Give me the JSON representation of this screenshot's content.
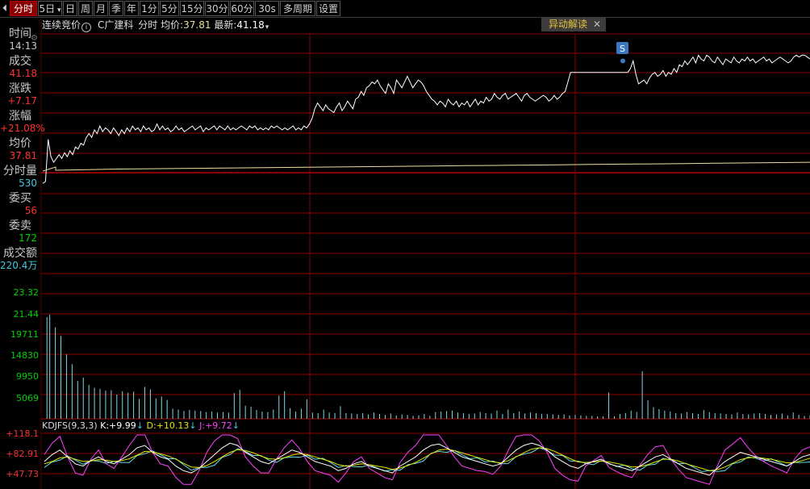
{
  "toolbar": {
    "arrow_icon": "step-back-icon",
    "tabs": [
      "分时",
      "5日",
      "日",
      "周",
      "月",
      "季",
      "年",
      "1分",
      "5分",
      "15分",
      "30分",
      "60分",
      "30s",
      "多周期",
      "设置"
    ],
    "active": "分时"
  },
  "sidebar": {
    "time_label": "时间",
    "time_value": "14:13",
    "deal_label": "成交",
    "deal_value": "41.18",
    "change_label": "涨跌",
    "change_value": "+7.17",
    "pct_label": "涨幅",
    "pct_value": "+21.08%",
    "avg_label": "均价",
    "avg_value": "37.81",
    "vol_label": "分时量",
    "vol_value": "530",
    "buy_label": "委买",
    "buy_value": "56",
    "sell_label": "委卖",
    "sell_value": "172",
    "amount_label": "成交额",
    "amount_value": "220.4万"
  },
  "infobar": {
    "mode": "连续竞价",
    "info_icon": "info-circle-icon",
    "stock": "C广建科",
    "period": "分时",
    "avg_label": "均价:",
    "avg_value": "37.81",
    "latest_label": "最新:",
    "latest_value": "41.18"
  },
  "abnormal_button": {
    "label": "异动解读",
    "close_icon": "close-icon"
  },
  "marker": {
    "label": "S"
  },
  "volume_axis": {
    "ticks": [
      "23.32",
      "21.44",
      "19711",
      "14830",
      "9950",
      "5069"
    ]
  },
  "kdj": {
    "name": "KDJFS(9,3,3)",
    "k_label": "K:",
    "k_value": "+9.99",
    "d_label": "D:",
    "d_value": "+10.13",
    "j_label": "J:",
    "j_value": "+9.72",
    "axis": [
      "+118.1",
      "+82.91",
      "+47.73"
    ]
  },
  "colors": {
    "up": "#ff3030",
    "down": "#00d000",
    "price_line": "#ffffff",
    "avg_line": "#e8e0a0",
    "volume": "#7fd8e8",
    "grid": "#8b0000",
    "k": "#ffffff",
    "d": "#e6e600",
    "j": "#ff40ff",
    "kdj_extra": "#60e0e0"
  },
  "chart_data": {
    "type": "line",
    "series": [
      {
        "name": "成交",
        "values": [
          34.2,
          34.3,
          36.5,
          35.6,
          35.3,
          35.5,
          35.7,
          35.5,
          35.8,
          35.6,
          35.9,
          35.7,
          36.1,
          36.0,
          36.3,
          36.2,
          36.6,
          36.8,
          36.6,
          37.0,
          36.8,
          37.2,
          36.9,
          37.1,
          37.0,
          36.8,
          37.1,
          36.9,
          36.7,
          37.0,
          36.8,
          37.1,
          36.9,
          37.2,
          37.0,
          37.1,
          36.9,
          37.2,
          37.0,
          37.1,
          36.9,
          37.0,
          37.3,
          37.0,
          37.2,
          37.0,
          37.1,
          36.9,
          37.0,
          37.2,
          37.0,
          37.1,
          36.9,
          37.0,
          37.1,
          37.2,
          37.0,
          37.1,
          37.2,
          36.9,
          37.1,
          37.0,
          37.1,
          37.2,
          37.0,
          37.2,
          37.1,
          37.0,
          37.2,
          37.0,
          37.1,
          37.0,
          37.1,
          37.2,
          37.1,
          37.0,
          37.2,
          37.1,
          37.2,
          37.0,
          37.1,
          37.0,
          37.1,
          37.0,
          37.2,
          37.1,
          37.2,
          37.1,
          37.0,
          37.1,
          37.0,
          37.1,
          37.2,
          37.0,
          37.1,
          37.0,
          37.2,
          37.1,
          37.3,
          37.6,
          38.1,
          38.4,
          38.2,
          38.0,
          38.3,
          38.1,
          38.0,
          37.9,
          38.2,
          38.4,
          38.0,
          38.2,
          38.5,
          38.3,
          38.1,
          38.6,
          38.7,
          39.0,
          38.8,
          39.2,
          39.3,
          39.5,
          39.4,
          39.6,
          39.3,
          39.1,
          38.9,
          39.4,
          39.2,
          38.9,
          39.6,
          39.4,
          39.2,
          39.5,
          39.8,
          39.5,
          39.2,
          39.4,
          39.6,
          39.5,
          39.3,
          39.0,
          38.8,
          38.6,
          38.5,
          38.3,
          38.5,
          38.4,
          38.2,
          38.6,
          38.4,
          38.3,
          38.5,
          38.2,
          38.4,
          38.3,
          38.5,
          38.2,
          38.4,
          38.6,
          38.3,
          38.5,
          38.4,
          38.7,
          38.5,
          38.6,
          38.9,
          38.7,
          38.6,
          38.8,
          38.9,
          38.6,
          38.7,
          38.8,
          38.9,
          38.7,
          38.5,
          38.8,
          38.9,
          38.7,
          38.6,
          38.5,
          38.6,
          38.7,
          38.8,
          38.7,
          38.5,
          38.6,
          38.8,
          38.6,
          38.7,
          38.9,
          39.0,
          39.5,
          40.0,
          40.0,
          40.0,
          40.0,
          40.0,
          40.0,
          40.0,
          40.0,
          40.0,
          40.0,
          40.0,
          40.0,
          40.0,
          40.0,
          40.0,
          40.0,
          40.0,
          40.0,
          40.0,
          40.0,
          40.0,
          40.0,
          40.2,
          40.6,
          39.9,
          39.4,
          39.5,
          39.6,
          39.4,
          39.7,
          39.9,
          40.0,
          39.8,
          39.9,
          40.1,
          39.8,
          40.0,
          39.9,
          40.2,
          40.0,
          40.4,
          40.3,
          40.6,
          40.4,
          40.6,
          40.8,
          40.5,
          40.9,
          40.7,
          40.6,
          40.9,
          40.8,
          40.6,
          40.5,
          40.8,
          40.6,
          40.4,
          40.7,
          40.6,
          40.5,
          40.8,
          40.6,
          40.5,
          40.7,
          40.6,
          40.8,
          40.6,
          40.7,
          40.5,
          40.6,
          40.7,
          40.8,
          40.6,
          40.7,
          40.5,
          40.6,
          40.7,
          40.8,
          40.7,
          40.6,
          40.5,
          40.6,
          40.8,
          40.9,
          40.8,
          40.9,
          40.9,
          40.8,
          40.7
        ]
      },
      {
        "name": "均价",
        "values": [
          36.5,
          36.6,
          36.7,
          36.75,
          36.8,
          36.85,
          36.9,
          36.95,
          37.0,
          37.05,
          37.1,
          37.15,
          37.2,
          37.25,
          37.3,
          37.35,
          37.4,
          37.45,
          37.5,
          37.55,
          37.6,
          37.65,
          37.7,
          37.75,
          37.81
        ]
      }
    ],
    "volume": [
      {
        "i": 3,
        "v": 21000
      },
      {
        "i": 5,
        "v": 21500
      },
      {
        "i": 9,
        "v": 18900
      },
      {
        "i": 13,
        "v": 17100
      },
      {
        "i": 17,
        "v": 13300
      },
      {
        "i": 21,
        "v": 11300
      },
      {
        "i": 25,
        "v": 7800
      },
      {
        "i": 29,
        "v": 8500
      },
      {
        "i": 33,
        "v": 7000
      },
      {
        "i": 37,
        "v": 6400
      },
      {
        "i": 41,
        "v": 6200
      },
      {
        "i": 45,
        "v": 5800
      },
      {
        "i": 49,
        "v": 5900
      },
      {
        "i": 53,
        "v": 5000
      },
      {
        "i": 57,
        "v": 5700
      },
      {
        "i": 61,
        "v": 5400
      },
      {
        "i": 65,
        "v": 5600
      },
      {
        "i": 69,
        "v": 4100
      },
      {
        "i": 73,
        "v": 6600
      },
      {
        "i": 77,
        "v": 6100
      },
      {
        "i": 81,
        "v": 4200
      },
      {
        "i": 85,
        "v": 4600
      },
      {
        "i": 89,
        "v": 3900
      },
      {
        "i": 93,
        "v": 2100
      },
      {
        "i": 97,
        "v": 1900
      },
      {
        "i": 101,
        "v": 1600
      },
      {
        "i": 105,
        "v": 1800
      },
      {
        "i": 109,
        "v": 1700
      },
      {
        "i": 113,
        "v": 1600
      },
      {
        "i": 117,
        "v": 1400
      },
      {
        "i": 121,
        "v": 1500
      },
      {
        "i": 125,
        "v": 1300
      },
      {
        "i": 129,
        "v": 1400
      },
      {
        "i": 133,
        "v": 1300
      },
      {
        "i": 137,
        "v": 5300
      },
      {
        "i": 141,
        "v": 6000
      },
      {
        "i": 145,
        "v": 2700
      },
      {
        "i": 149,
        "v": 2500
      },
      {
        "i": 153,
        "v": 1800
      },
      {
        "i": 157,
        "v": 1500
      },
      {
        "i": 161,
        "v": 1400
      },
      {
        "i": 165,
        "v": 1900
      },
      {
        "i": 169,
        "v": 4800
      },
      {
        "i": 173,
        "v": 5700
      },
      {
        "i": 177,
        "v": 2200
      },
      {
        "i": 181,
        "v": 1500
      },
      {
        "i": 185,
        "v": 2100
      },
      {
        "i": 189,
        "v": 4000
      },
      {
        "i": 193,
        "v": 1300
      },
      {
        "i": 197,
        "v": 1200
      },
      {
        "i": 201,
        "v": 1900
      },
      {
        "i": 205,
        "v": 1300
      },
      {
        "i": 209,
        "v": 1200
      },
      {
        "i": 213,
        "v": 2600
      },
      {
        "i": 217,
        "v": 1200
      },
      {
        "i": 221,
        "v": 1100
      },
      {
        "i": 225,
        "v": 1000
      },
      {
        "i": 229,
        "v": 1200
      },
      {
        "i": 233,
        "v": 900
      },
      {
        "i": 237,
        "v": 1300
      },
      {
        "i": 241,
        "v": 1000
      },
      {
        "i": 245,
        "v": 800
      },
      {
        "i": 249,
        "v": 1100
      },
      {
        "i": 253,
        "v": 700
      },
      {
        "i": 257,
        "v": 900
      },
      {
        "i": 261,
        "v": 800
      },
      {
        "i": 265,
        "v": 600
      },
      {
        "i": 269,
        "v": 700
      },
      {
        "i": 273,
        "v": 1000
      },
      {
        "i": 277,
        "v": 600
      },
      {
        "i": 281,
        "v": 1400
      },
      {
        "i": 285,
        "v": 1500
      },
      {
        "i": 289,
        "v": 1600
      },
      {
        "i": 293,
        "v": 1700
      },
      {
        "i": 297,
        "v": 1300
      },
      {
        "i": 301,
        "v": 1200
      },
      {
        "i": 305,
        "v": 1000
      },
      {
        "i": 309,
        "v": 1100
      },
      {
        "i": 313,
        "v": 1400
      },
      {
        "i": 317,
        "v": 1200
      },
      {
        "i": 321,
        "v": 1100
      },
      {
        "i": 325,
        "v": 1700
      },
      {
        "i": 329,
        "v": 1000
      },
      {
        "i": 333,
        "v": 1900
      },
      {
        "i": 337,
        "v": 1200
      },
      {
        "i": 341,
        "v": 1500
      },
      {
        "i": 345,
        "v": 1100
      },
      {
        "i": 349,
        "v": 1300
      },
      {
        "i": 353,
        "v": 1200
      },
      {
        "i": 357,
        "v": 1000
      },
      {
        "i": 361,
        "v": 1000
      },
      {
        "i": 365,
        "v": 900
      },
      {
        "i": 369,
        "v": 800
      },
      {
        "i": 373,
        "v": 900
      },
      {
        "i": 377,
        "v": 700
      },
      {
        "i": 381,
        "v": 800
      },
      {
        "i": 385,
        "v": 700
      },
      {
        "i": 389,
        "v": 600
      },
      {
        "i": 393,
        "v": 600
      },
      {
        "i": 397,
        "v": 500
      },
      {
        "i": 401,
        "v": 500
      },
      {
        "i": 405,
        "v": 5400
      },
      {
        "i": 409,
        "v": 500
      },
      {
        "i": 413,
        "v": 1000
      },
      {
        "i": 417,
        "v": 1200
      },
      {
        "i": 421,
        "v": 1700
      },
      {
        "i": 425,
        "v": 1400
      },
      {
        "i": 429,
        "v": 9800
      },
      {
        "i": 433,
        "v": 3800
      },
      {
        "i": 437,
        "v": 2400
      },
      {
        "i": 441,
        "v": 2000
      },
      {
        "i": 445,
        "v": 1700
      },
      {
        "i": 449,
        "v": 1500
      },
      {
        "i": 453,
        "v": 1200
      },
      {
        "i": 457,
        "v": 1100
      },
      {
        "i": 461,
        "v": 1400
      },
      {
        "i": 465,
        "v": 1200
      },
      {
        "i": 469,
        "v": 1000
      },
      {
        "i": 473,
        "v": 1800
      },
      {
        "i": 477,
        "v": 1400
      },
      {
        "i": 481,
        "v": 1200
      },
      {
        "i": 485,
        "v": 1100
      },
      {
        "i": 489,
        "v": 1000
      },
      {
        "i": 493,
        "v": 900
      },
      {
        "i": 497,
        "v": 1300
      },
      {
        "i": 501,
        "v": 1000
      },
      {
        "i": 505,
        "v": 900
      },
      {
        "i": 509,
        "v": 1100
      },
      {
        "i": 513,
        "v": 1200
      },
      {
        "i": 517,
        "v": 1000
      },
      {
        "i": 521,
        "v": 800
      },
      {
        "i": 525,
        "v": 900
      },
      {
        "i": 529,
        "v": 1100
      },
      {
        "i": 533,
        "v": 700
      },
      {
        "i": 537,
        "v": 1300
      },
      {
        "i": 541,
        "v": 800
      },
      {
        "i": 545,
        "v": 600
      },
      {
        "i": 549,
        "v": 700
      }
    ],
    "kdj_K": [
      60,
      75,
      85,
      70,
      55,
      50,
      62,
      70,
      60,
      55,
      65,
      75,
      90,
      95,
      80,
      70,
      65,
      50,
      40,
      35,
      45,
      60,
      75,
      90,
      100,
      95,
      80,
      70,
      60,
      55,
      65,
      75,
      85,
      80,
      70,
      60,
      55,
      50,
      40,
      45,
      55,
      60,
      50,
      45,
      40,
      35,
      50,
      60,
      70,
      85,
      95,
      98,
      90,
      80,
      70,
      65,
      60,
      55,
      50,
      55,
      70,
      85,
      95,
      100,
      95,
      85,
      70,
      60,
      50,
      45,
      55,
      60,
      65,
      55,
      50,
      45,
      40,
      50,
      60,
      70,
      75,
      65,
      55,
      45,
      40,
      35,
      30,
      45,
      60,
      70,
      80,
      75,
      70,
      65,
      60,
      55,
      50,
      60,
      70,
      75
    ],
    "kdj_D": [
      55,
      60,
      68,
      70,
      65,
      60,
      61,
      64,
      63,
      60,
      62,
      66,
      74,
      82,
      81,
      77,
      72,
      65,
      56,
      48,
      47,
      51,
      60,
      70,
      80,
      86,
      84,
      79,
      72,
      66,
      65,
      68,
      74,
      77,
      75,
      70,
      65,
      60,
      53,
      50,
      52,
      55,
      53,
      50,
      47,
      43,
      46,
      51,
      58,
      67,
      77,
      85,
      87,
      84,
      79,
      74,
      69,
      64,
      59,
      57,
      62,
      70,
      79,
      87,
      90,
      88,
      82,
      74,
      66,
      59,
      58,
      59,
      61,
      59,
      56,
      52,
      48,
      49,
      53,
      59,
      65,
      65,
      61,
      55,
      50,
      45,
      40,
      42,
      48,
      56,
      64,
      68,
      69,
      67,
      65,
      61,
      57,
      58,
      62,
      67
    ],
    "kdj_J": [
      75,
      100,
      115,
      70,
      35,
      30,
      65,
      85,
      55,
      45,
      70,
      95,
      118,
      118,
      80,
      55,
      50,
      25,
      10,
      10,
      40,
      80,
      105,
      118,
      118,
      110,
      70,
      50,
      35,
      35,
      65,
      90,
      107,
      88,
      60,
      40,
      35,
      30,
      15,
      35,
      60,
      70,
      45,
      35,
      25,
      20,
      58,
      80,
      95,
      118,
      118,
      118,
      95,
      70,
      50,
      45,
      40,
      38,
      32,
      50,
      85,
      115,
      118,
      118,
      105,
      80,
      45,
      30,
      20,
      17,
      50,
      62,
      73,
      47,
      38,
      30,
      25,
      52,
      75,
      92,
      95,
      65,
      43,
      25,
      20,
      15,
      10,
      50,
      85,
      98,
      112,
      90,
      72,
      60,
      50,
      43,
      35,
      65,
      85,
      92
    ]
  }
}
